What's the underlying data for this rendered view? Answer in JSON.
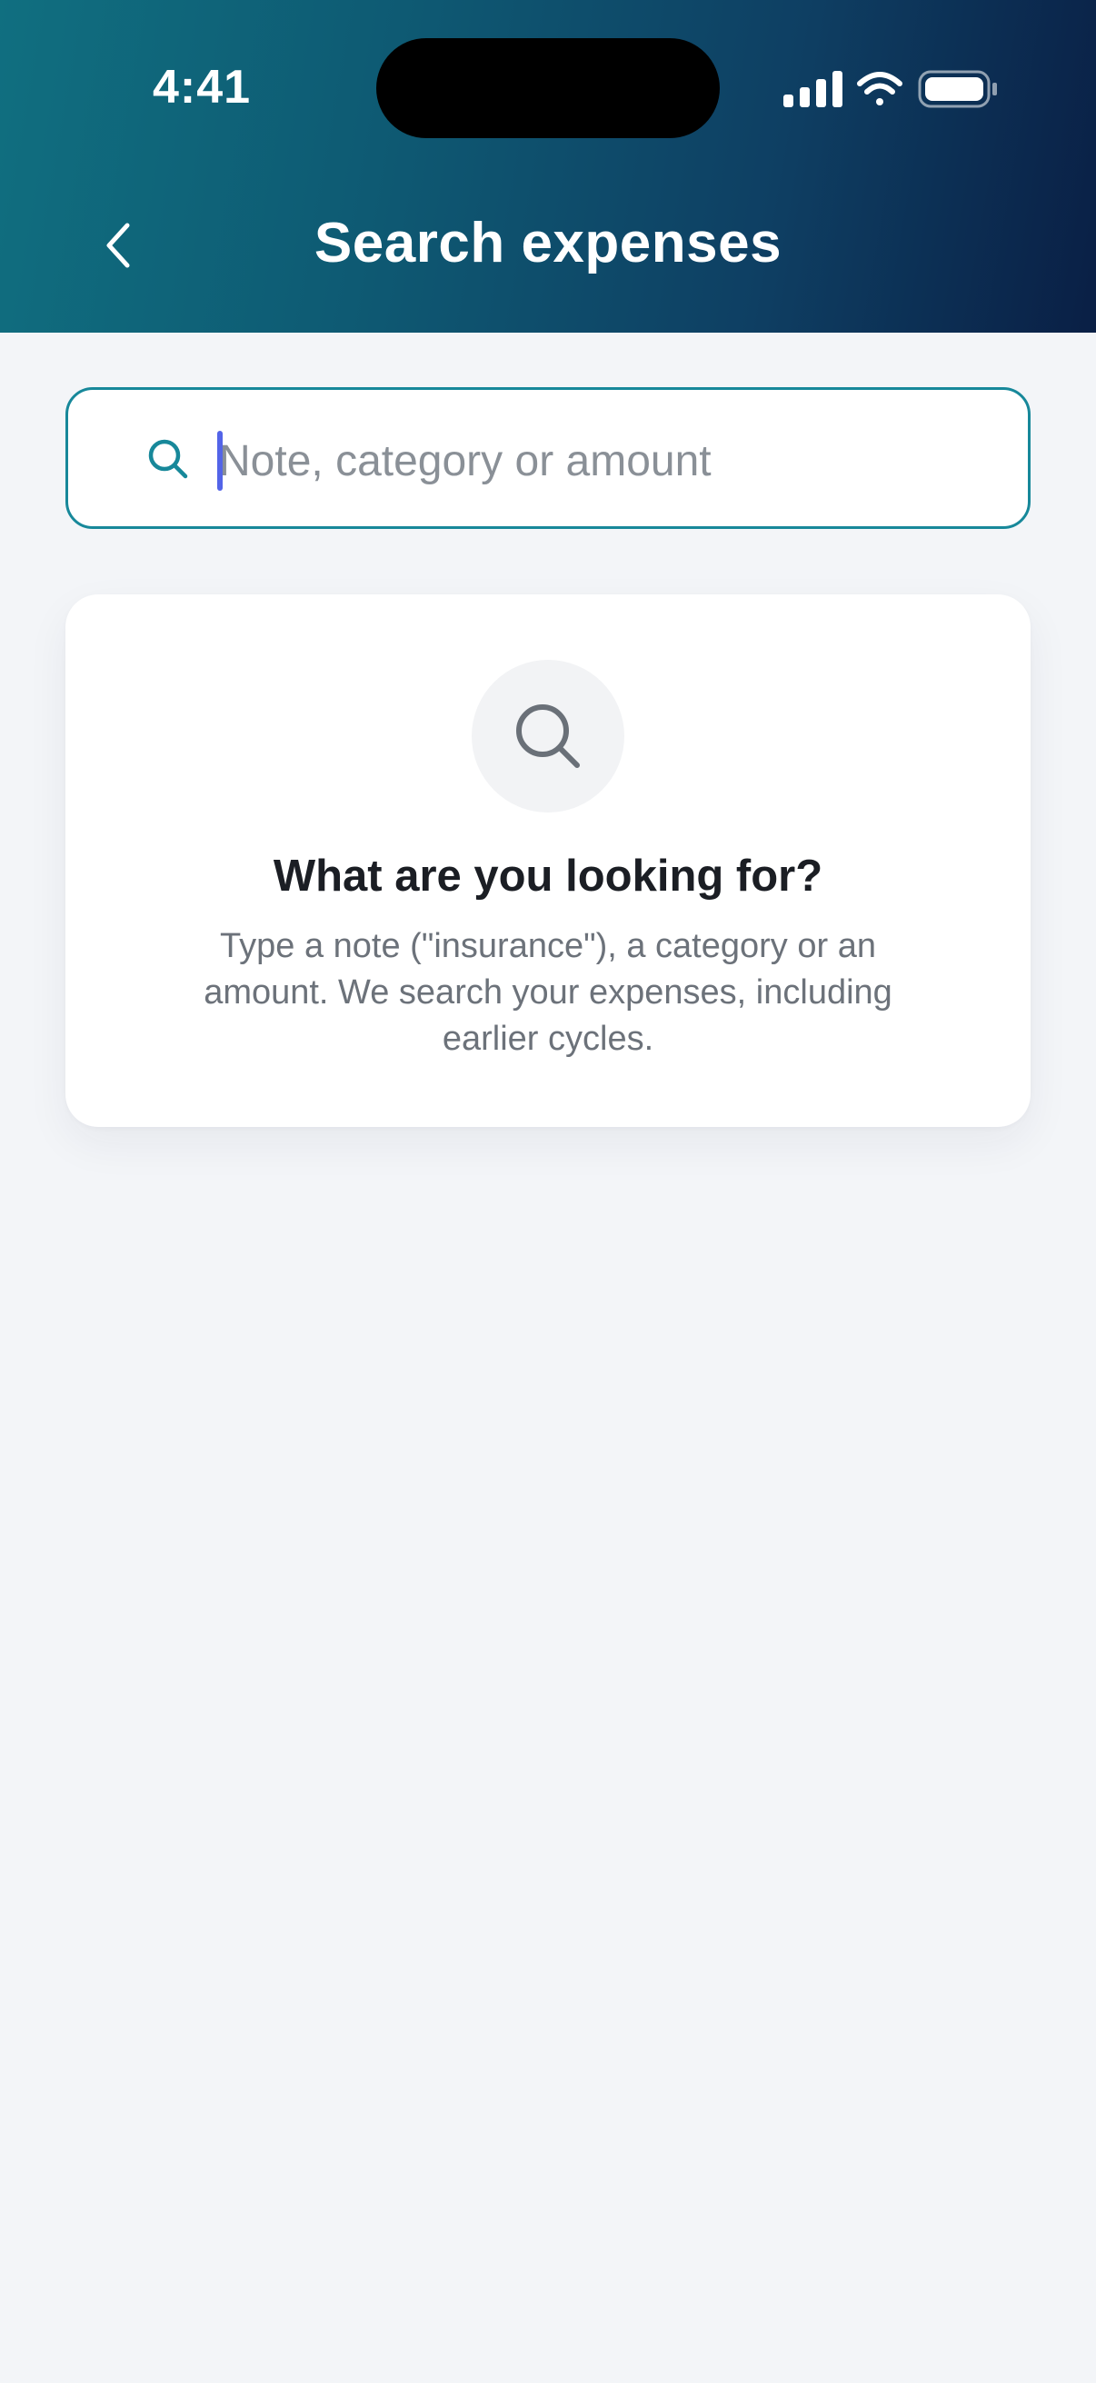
{
  "status_bar": {
    "time": "4:41"
  },
  "header": {
    "title": "Search expenses",
    "back_icon": "chevron-left-icon",
    "gradient_colors": [
      "#106f80",
      "#0a1f45"
    ]
  },
  "search": {
    "value": "",
    "placeholder": "Note, category or amount",
    "icon": "search-icon",
    "accent_color": "#17889a"
  },
  "empty_state": {
    "icon": "search-icon",
    "title": "What are you looking for?",
    "description": "Type a note (\"insurance\"), a category or an amount. We search your expenses, including earlier cycles."
  }
}
